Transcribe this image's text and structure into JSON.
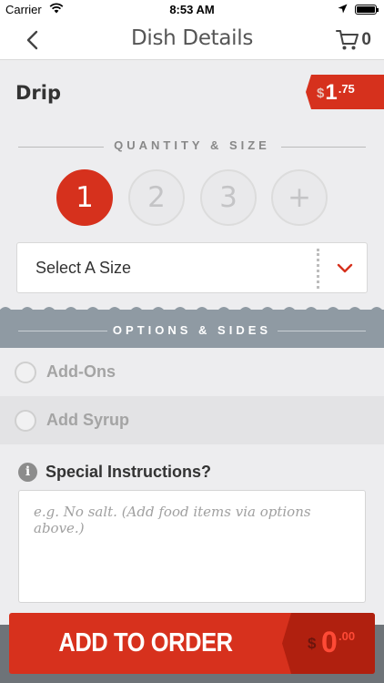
{
  "status_bar": {
    "carrier": "Carrier",
    "time": "8:53 AM"
  },
  "nav": {
    "title": "Dish Details",
    "cart_count": "0"
  },
  "dish": {
    "name": "Drip",
    "price_currency": "$",
    "price_dollars": "1",
    "price_cents": ".75"
  },
  "quantity_section": {
    "label": "QUANTITY & SIZE",
    "options": [
      "1",
      "2",
      "3",
      "+"
    ],
    "selected": "1"
  },
  "size_select": {
    "value": "Select A Size"
  },
  "options_section": {
    "label": "OPTIONS & SIDES"
  },
  "option_groups": [
    {
      "label": "Add-Ons"
    },
    {
      "label": "Add Syrup"
    }
  ],
  "special_instructions": {
    "info_glyph": "i",
    "label": "Special Instructions?",
    "placeholder": "e.g. No salt. (Add food items via options above.)"
  },
  "add_button": {
    "label": "ADD TO ORDER",
    "price_currency": "$",
    "price_dollars": "0",
    "price_cents": ".00"
  },
  "colors": {
    "accent_red": "#d6311d",
    "options_band": "#8f9aa3",
    "background": "#ededef"
  }
}
